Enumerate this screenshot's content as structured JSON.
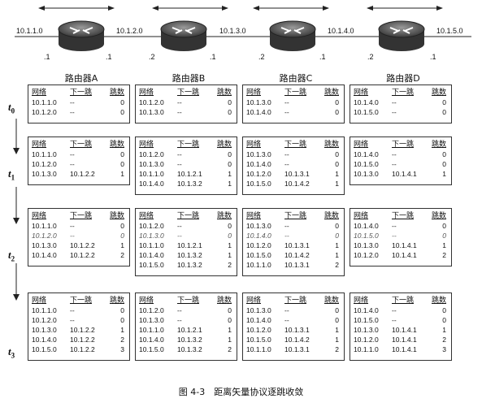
{
  "networks": [
    "10.1.1.0",
    "10.1.2.0",
    "10.1.3.0",
    "10.1.4.0",
    "10.1.5.0"
  ],
  "interfaces": [
    ".1",
    ".1",
    ".2",
    ".1",
    ".2",
    ".1",
    ".2",
    ".1"
  ],
  "routers": [
    "路由器A",
    "路由器B",
    "路由器C",
    "路由器D"
  ],
  "headers": {
    "network": "网络",
    "next_hop": "下一跳",
    "hops": "跳数"
  },
  "time_steps": [
    {
      "t": "t",
      "sub": "0"
    },
    {
      "t": "t",
      "sub": "1"
    },
    {
      "t": "t",
      "sub": "2"
    },
    {
      "t": "t",
      "sub": "3"
    }
  ],
  "tables": [
    [
      [
        [
          "10.1.1.0",
          "--",
          "0"
        ],
        [
          "10.1.2.0",
          "--",
          "0"
        ]
      ],
      [
        [
          "10.1.2.0",
          "--",
          "0"
        ],
        [
          "10.1.3.0",
          "--",
          "0"
        ]
      ],
      [
        [
          "10.1.3.0",
          "--",
          "0"
        ],
        [
          "10.1.4.0",
          "--",
          "0"
        ]
      ],
      [
        [
          "10.1.4.0",
          "--",
          "0"
        ],
        [
          "10.1.5.0",
          "--",
          "0"
        ]
      ]
    ],
    [
      [
        [
          "10.1.1.0",
          "--",
          "0"
        ],
        [
          "10.1.2.0",
          "--",
          "0"
        ],
        [
          "10.1.3.0",
          "10.1.2.2",
          "1"
        ]
      ],
      [
        [
          "10.1.2.0",
          "--",
          "0"
        ],
        [
          "10.1.3.0",
          "--",
          "0"
        ],
        [
          "10.1.1.0",
          "10.1.2.1",
          "1"
        ],
        [
          "10.1.4.0",
          "10.1.3.2",
          "1"
        ]
      ],
      [
        [
          "10.1.3.0",
          "--",
          "0"
        ],
        [
          "10.1.4.0",
          "--",
          "0"
        ],
        [
          "10.1.2.0",
          "10.1.3.1",
          "1"
        ],
        [
          "10.1.5.0",
          "10.1.4.2",
          "1"
        ]
      ],
      [
        [
          "10.1.4.0",
          "--",
          "0"
        ],
        [
          "10.1.5.0",
          "--",
          "0"
        ],
        [
          "10.1.3.0",
          "10.1.4.1",
          "1"
        ]
      ]
    ],
    [
      [
        [
          "10.1.1.0",
          "--",
          "0"
        ],
        [
          "10.1.2.0",
          "--",
          "0"
        ],
        [
          "10.1.3.0",
          "10.1.2.2",
          "1"
        ],
        [
          "10.1.4.0",
          "10.1.2.2",
          "2"
        ]
      ],
      [
        [
          "10.1.2.0",
          "--",
          "0"
        ],
        [
          "10.1.3.0",
          "--",
          "0"
        ],
        [
          "10.1.1.0",
          "10.1.2.1",
          "1"
        ],
        [
          "10.1.4.0",
          "10.1.3.2",
          "1"
        ],
        [
          "10.1.5.0",
          "10.1.3.2",
          "2"
        ]
      ],
      [
        [
          "10.1.3.0",
          "--",
          "0"
        ],
        [
          "10.1.4.0",
          "--",
          "0"
        ],
        [
          "10.1.2.0",
          "10.1.3.1",
          "1"
        ],
        [
          "10.1.5.0",
          "10.1.4.2",
          "1"
        ],
        [
          "10.1.1.0",
          "10.1.3.1",
          "2"
        ]
      ],
      [
        [
          "10.1.4.0",
          "--",
          "0"
        ],
        [
          "10.1.5.0",
          "--",
          "0"
        ],
        [
          "10.1.3.0",
          "10.1.4.1",
          "1"
        ],
        [
          "10.1.2.0",
          "10.1.4.1",
          "2"
        ]
      ]
    ],
    [
      [
        [
          "10.1.1.0",
          "--",
          "0"
        ],
        [
          "10.1.2.0",
          "--",
          "0"
        ],
        [
          "10.1.3.0",
          "10.1.2.2",
          "1"
        ],
        [
          "10.1.4.0",
          "10.1.2.2",
          "2"
        ],
        [
          "10.1.5.0",
          "10.1.2.2",
          "3"
        ]
      ],
      [
        [
          "10.1.2.0",
          "--",
          "0"
        ],
        [
          "10.1.3.0",
          "--",
          "0"
        ],
        [
          "10.1.1.0",
          "10.1.2.1",
          "1"
        ],
        [
          "10.1.4.0",
          "10.1.3.2",
          "1"
        ],
        [
          "10.1.5.0",
          "10.1.3.2",
          "2"
        ]
      ],
      [
        [
          "10.1.3.0",
          "--",
          "0"
        ],
        [
          "10.1.4.0",
          "--",
          "0"
        ],
        [
          "10.1.2.0",
          "10.1.3.1",
          "1"
        ],
        [
          "10.1.5.0",
          "10.1.4.2",
          "1"
        ],
        [
          "10.1.1.0",
          "10.1.3.1",
          "2"
        ]
      ],
      [
        [
          "10.1.4.0",
          "--",
          "0"
        ],
        [
          "10.1.5.0",
          "--",
          "0"
        ],
        [
          "10.1.3.0",
          "10.1.4.1",
          "1"
        ],
        [
          "10.1.2.0",
          "10.1.4.1",
          "2"
        ],
        [
          "10.1.1.0",
          "10.1.4.1",
          "3"
        ]
      ]
    ]
  ],
  "caption": "图 4-3　距离矢量协议逐跳收敛"
}
